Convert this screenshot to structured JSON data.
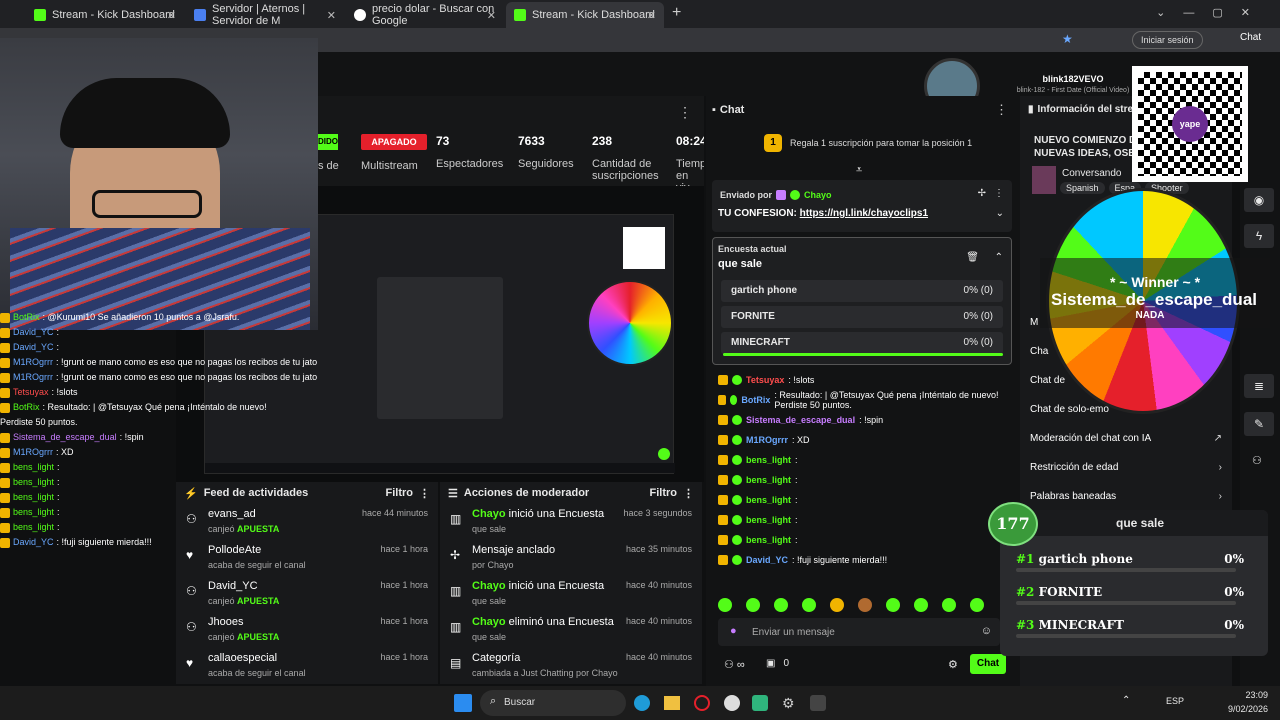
{
  "tabs": [
    {
      "label": "Stream - Kick Dashboard",
      "active": false
    },
    {
      "label": "Servidor | Aternos | Servidor de M",
      "active": false
    },
    {
      "label": "precio dolar - Buscar con Google",
      "active": false
    },
    {
      "label": "Stream - Kick Dashboard",
      "active": true
    }
  ],
  "browser": {
    "signin": "Iniciar sesión",
    "chat": "Chat"
  },
  "now_playing": {
    "user": "blink182VEVO",
    "title": "blink-182 - First Date (Official Video)"
  },
  "stats": {
    "status1": "DIDO",
    "status1_label": "s de",
    "multistream_badge": "APAGADO",
    "multistream_label": "Multistream",
    "viewers": "73",
    "viewers_label": "Espectadores",
    "followers": "7633",
    "followers_label": "Seguidores",
    "subs": "238",
    "subs_label": "Cantidad de suscripciones",
    "time": "08:24",
    "time_label": "Tiemp en viv"
  },
  "overlay_chat": [
    {
      "user": "BotRix",
      "text": ": @Kurumi10 Se añadieron 10 puntos a @Jsrafu.",
      "color": "#53fc18"
    },
    {
      "user": "David_YC",
      "text": ":",
      "color": "#6aa8ff"
    },
    {
      "user": "David_YC",
      "text": ":",
      "color": "#6aa8ff"
    },
    {
      "user": "M1ROgrrr",
      "text": ": !grunt oe mano como es eso que no pagas los recibos de tu jato",
      "color": "#6aa8ff"
    },
    {
      "user": "M1ROgrrr",
      "text": ": !grunt oe mano como es eso que no pagas los recibos de tu jato",
      "color": "#6aa8ff"
    },
    {
      "user": "Tetsuyax",
      "text": ": !slots",
      "color": "#ff4d4d"
    },
    {
      "user": "BotRix",
      "text": ": Resultado: | @Tetsuyax Qué pena ¡Inténtalo de nuevo!",
      "color": "#53fc18"
    },
    {
      "user": "",
      "text": "Perdiste 50 puntos.",
      "color": "#fff"
    },
    {
      "user": "Sistema_de_escape_dual",
      "text": ": !spin",
      "color": "#c77dff"
    },
    {
      "user": "M1ROgrrr",
      "text": ": XD",
      "color": "#6aa8ff"
    },
    {
      "user": "bens_light",
      "text": ":",
      "color": "#53fc18"
    },
    {
      "user": "bens_light",
      "text": ":",
      "color": "#53fc18"
    },
    {
      "user": "bens_light",
      "text": ":",
      "color": "#53fc18"
    },
    {
      "user": "bens_light",
      "text": ":",
      "color": "#53fc18"
    },
    {
      "user": "bens_light",
      "text": ":",
      "color": "#53fc18"
    },
    {
      "user": "David_YC",
      "text": ": !fuji siguiente mierda!!!",
      "color": "#6aa8ff"
    }
  ],
  "activity": {
    "title": "Feed de actividades",
    "filter": "Filtro",
    "items": [
      {
        "name": "evans_ad",
        "sub": "canjeó",
        "sub_green": "APUESTA",
        "time": "hace 44 minutos"
      },
      {
        "name": "PollodeAte",
        "sub": "acaba de seguir el canal",
        "sub_green": "",
        "time": "hace 1 hora"
      },
      {
        "name": "David_YC",
        "sub": "canjeó",
        "sub_green": "APUESTA",
        "time": "hace 1 hora"
      },
      {
        "name": "Jhooes",
        "sub": "canjeó",
        "sub_green": "APUESTA",
        "time": "hace 1 hora"
      },
      {
        "name": "callaoespecial",
        "sub": "acaba de seguir el canal",
        "sub_green": "",
        "time": "hace 1 hora"
      }
    ]
  },
  "modactions": {
    "title": "Acciones de moderador",
    "filter": "Filtro",
    "items": [
      {
        "actor": "Chayo",
        "action": " inició una Encuesta",
        "sub": "que sale",
        "time": "hace 3 segundos"
      },
      {
        "actor": "",
        "action": "Mensaje anclado",
        "sub": "por Chayo",
        "time": "hace 35 minutos"
      },
      {
        "actor": "Chayo",
        "action": " inició una Encuesta",
        "sub": "que sale",
        "time": "hace 40 minutos"
      },
      {
        "actor": "Chayo",
        "action": " eliminó una Encuesta",
        "sub": "que sale",
        "time": "hace 40 minutos"
      },
      {
        "actor": "",
        "action": "Categoría",
        "sub": "cambiada a Just Chatting por Chayo",
        "time": "hace 40 minutos"
      }
    ]
  },
  "chat": {
    "title": "Chat",
    "sub_gift": "Regala 1 suscripción para tomar la posición 1",
    "pinned_by": "Enviado por",
    "pinned_user": "Chayo",
    "pinned_text": "TU CONFESION: ",
    "pinned_link": "https://ngl.link/chayoclips1",
    "poll_label": "Encuesta actual",
    "poll_question": "que sale",
    "poll_options": [
      {
        "label": "gartich phone",
        "value": "0% (0)"
      },
      {
        "label": "FORNITE",
        "value": "0% (0)"
      },
      {
        "label": "MINECRAFT",
        "value": "0% (0)"
      }
    ],
    "messages": [
      {
        "user": "Tetsuyax",
        "color": "#ff4d4d",
        "text": ": !slots"
      },
      {
        "user": "BotRix",
        "color": "#6aa8ff",
        "text": ": Resultado: | @Tetsuyax Qué pena ¡Inténtalo de nuevo! Perdiste 50 puntos."
      },
      {
        "user": "Sistema_de_escape_dual",
        "color": "#c77dff",
        "text": ": !spin"
      },
      {
        "user": "M1ROgrrr",
        "color": "#6aa8ff",
        "text": ": XD"
      },
      {
        "user": "bens_light",
        "color": "#53fc18",
        "text": ":"
      },
      {
        "user": "bens_light",
        "color": "#53fc18",
        "text": ":"
      },
      {
        "user": "bens_light",
        "color": "#53fc18",
        "text": ":"
      },
      {
        "user": "bens_light",
        "color": "#53fc18",
        "text": ":"
      },
      {
        "user": "bens_light",
        "color": "#53fc18",
        "text": ":"
      },
      {
        "user": "David_YC",
        "color": "#6aa8ff",
        "text": ": !fuji siguiente mierda!!!"
      }
    ],
    "input_placeholder": "Enviar un mensaje",
    "points": "0",
    "send": "Chat"
  },
  "stream_info": {
    "title": "Información del stre",
    "stream_title": "NUEVO COMIENZO D NUEVAS IDEAS, OSEA",
    "category": "Conversando",
    "tags": [
      "Spanish",
      "Espa",
      "Shooter"
    ]
  },
  "settings": [
    {
      "label": "M"
    },
    {
      "label": "Cha"
    },
    {
      "label": "Chat de"
    },
    {
      "label": "Chat de solo-emo"
    },
    {
      "label": "Moderación del chat con IA"
    },
    {
      "label": "Restricción de edad"
    },
    {
      "label": "Palabras baneadas"
    }
  ],
  "wheel": {
    "winner_label": "* ~ Winner ~ *",
    "winner": "Sistema_de_escape_dual",
    "slot": "NADA"
  },
  "poll_widget": {
    "count": "177",
    "question": "que sale",
    "options": [
      {
        "rank": "#1",
        "label": "gartich phone",
        "pct": "0%"
      },
      {
        "rank": "#2",
        "label": "FORNITE",
        "pct": "0%"
      },
      {
        "rank": "#3",
        "label": "MINECRAFT",
        "pct": "0%"
      }
    ]
  },
  "taskbar": {
    "search": "Buscar",
    "lang": "ESP",
    "time": "23:09",
    "date": "9/02/2026"
  },
  "qr_label": "yape",
  "colors": {
    "kick_green": "#53fc18",
    "badge_red": "#e5202b"
  }
}
